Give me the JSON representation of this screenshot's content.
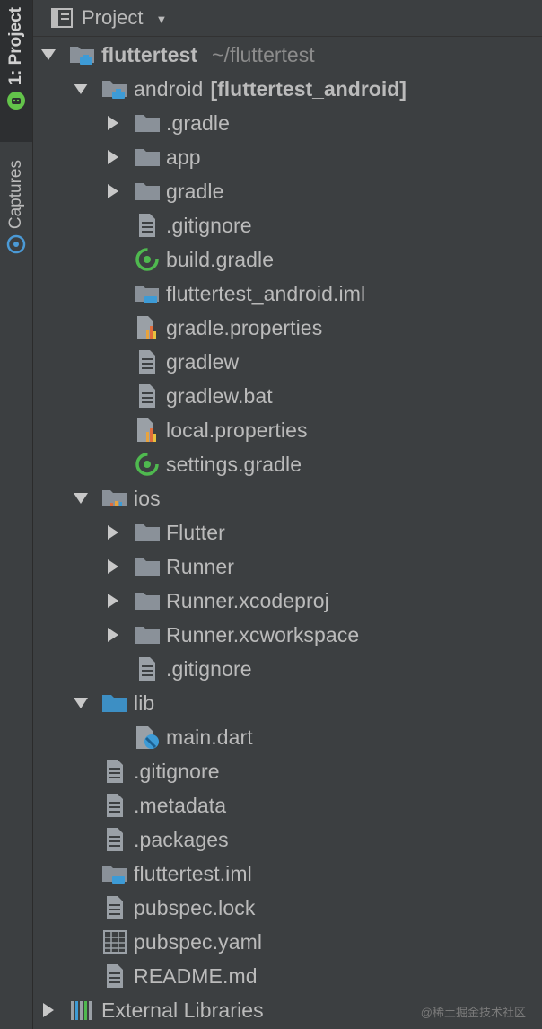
{
  "toolwindow_strip": {
    "project_tab": "1: Project",
    "captures_tab": "Captures"
  },
  "header": {
    "title": "Project"
  },
  "tree": {
    "root": {
      "name": "fluttertest",
      "path": "~/fluttertest"
    },
    "android": {
      "name": "android",
      "module": "[fluttertest_android]"
    },
    "android_children": [
      ".gradle",
      "app",
      "gradle",
      ".gitignore",
      "build.gradle",
      "fluttertest_android.iml",
      "gradle.properties",
      "gradlew",
      "gradlew.bat",
      "local.properties",
      "settings.gradle"
    ],
    "ios": {
      "name": "ios"
    },
    "ios_children": [
      "Flutter",
      "Runner",
      "Runner.xcodeproj",
      "Runner.xcworkspace",
      ".gitignore"
    ],
    "lib": {
      "name": "lib"
    },
    "lib_children": [
      "main.dart"
    ],
    "root_files": [
      ".gitignore",
      ".metadata",
      ".packages",
      "fluttertest.iml",
      "pubspec.lock",
      "pubspec.yaml",
      "README.md"
    ],
    "external": "External Libraries"
  },
  "watermark": "@稀土掘金技术社区",
  "colors": {
    "background": "#3c3f41",
    "text": "#bbbbbb",
    "folder": "#8a9199",
    "module_blue": "#3d9bd6",
    "gradle_green": "#4fb94f",
    "lib_folder": "#3d8fc4"
  }
}
